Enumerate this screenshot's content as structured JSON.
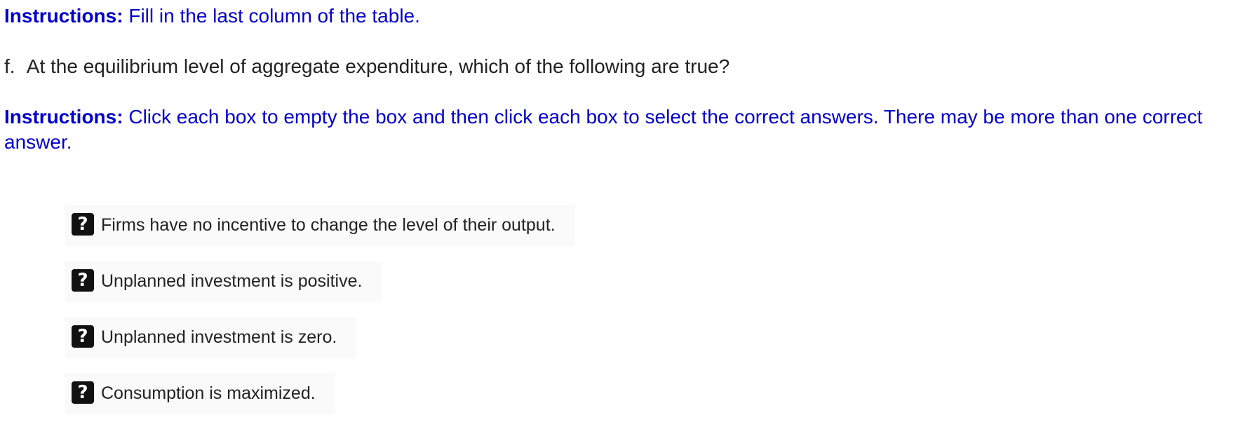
{
  "instructions_1": {
    "label": "Instructions:",
    "text": "Fill in the last column of the table."
  },
  "question": {
    "number": "f.",
    "text": "At the equilibrium level of aggregate expenditure, which of the following are true?"
  },
  "instructions_2": {
    "label": "Instructions:",
    "text": "Click each box to empty the box and then click each box to select the correct answers. There may be more than one correct answer."
  },
  "options": [
    {
      "marker": "?",
      "text": "Firms have no incentive to change the level of their output."
    },
    {
      "marker": "?",
      "text": "Unplanned investment is positive."
    },
    {
      "marker": "?",
      "text": "Unplanned investment is zero."
    },
    {
      "marker": "?",
      "text": "Consumption is maximized."
    }
  ],
  "colors": {
    "instruction_blue": "#0000cc",
    "box_black": "#111111",
    "option_background": "#fafafa"
  }
}
